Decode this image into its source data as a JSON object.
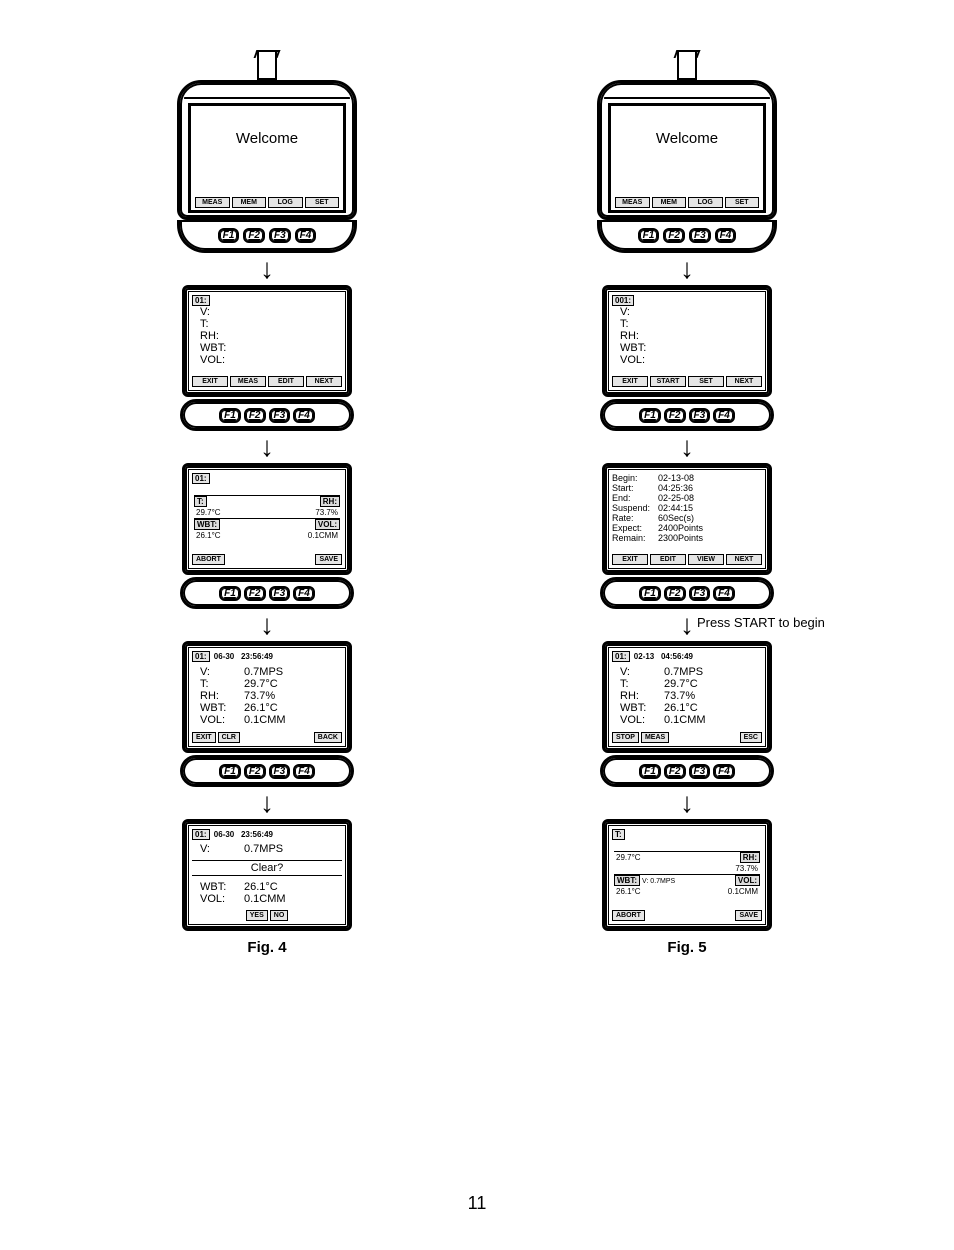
{
  "page_number": "11",
  "fig4": {
    "caption": "Fig. 4",
    "device": {
      "welcome": "Welcome",
      "softkeys": [
        "MEAS",
        "MEM",
        "LOG",
        "SET"
      ],
      "fkeys": [
        "F1",
        "F2",
        "F3",
        "F4"
      ]
    },
    "step2": {
      "id": "01:",
      "rows": [
        "V:",
        "T:",
        "RH:",
        "WBT:",
        "VOL:"
      ],
      "softkeys": [
        "EXIT",
        "MEAS",
        "EDIT",
        "NEXT"
      ]
    },
    "step3": {
      "id": "01:",
      "cells": {
        "t_label": "T:",
        "t_val": "29.7°C",
        "rh_label": "RH:",
        "rh_val": "73.7%",
        "wbt_label": "WBT:",
        "wbt_val": "26.1°C",
        "vol_label": "VOL:",
        "vol_val": "0.1CMM"
      },
      "soft_left": "ABORT",
      "soft_right": "SAVE"
    },
    "step4": {
      "id": "01:",
      "date": "06-30",
      "time": "23:56:49",
      "rows": [
        [
          "V:",
          "0.7MPS"
        ],
        [
          "T:",
          "29.7°C"
        ],
        [
          "RH:",
          "73.7%"
        ],
        [
          "WBT:",
          "26.1°C"
        ],
        [
          "VOL:",
          "0.1CMM"
        ]
      ],
      "softkeys": [
        "EXIT",
        "CLR",
        "",
        "BACK"
      ]
    },
    "step5": {
      "id": "01:",
      "date": "06-30",
      "time": "23:56:49",
      "top": [
        [
          "V:",
          "0.7MPS"
        ]
      ],
      "dialog": "Clear?",
      "bottom": [
        [
          "WBT:",
          "26.1°C"
        ],
        [
          "VOL:",
          "0.1CMM"
        ]
      ],
      "softkeys": [
        "",
        "YES",
        "NO",
        ""
      ]
    }
  },
  "fig5": {
    "caption": "Fig. 5",
    "annotation": "Press START to begin",
    "device": {
      "welcome": "Welcome",
      "softkeys": [
        "MEAS",
        "MEM",
        "LOG",
        "SET"
      ],
      "fkeys": [
        "F1",
        "F2",
        "F3",
        "F4"
      ]
    },
    "step2": {
      "id": "001:",
      "rows": [
        "V:",
        "T:",
        "RH:",
        "WBT:",
        "VOL:"
      ],
      "softkeys": [
        "EXIT",
        "START",
        "SET",
        "NEXT"
      ]
    },
    "step3": {
      "rows": [
        [
          "Begin:",
          "02-13-08"
        ],
        [
          "Start:",
          "04:25:36"
        ],
        [
          "End:",
          "02-25-08"
        ],
        [
          "Suspend:",
          "02:44:15"
        ],
        [
          "Rate:",
          "60Sec(s)"
        ],
        [
          "Expect:",
          "2400Points"
        ],
        [
          "Remain:",
          "2300Points"
        ]
      ],
      "softkeys": [
        "EXIT",
        "EDIT",
        "VIEW",
        "NEXT"
      ]
    },
    "step4": {
      "id": "01:",
      "date": "02-13",
      "time": "04:56:49",
      "rows": [
        [
          "V:",
          "0.7MPS"
        ],
        [
          "T:",
          "29.7°C"
        ],
        [
          "RH:",
          "73.7%"
        ],
        [
          "WBT:",
          "26.1°C"
        ],
        [
          "VOL:",
          "0.1CMM"
        ]
      ],
      "softkeys": [
        "STOP",
        "MEAS",
        "",
        "ESC"
      ]
    },
    "step5": {
      "t_label": "T:",
      "t_val": "29.7°C",
      "v_note": "V:  0.7MPS",
      "rh_label": "RH:",
      "rh_val": "73.7%",
      "wbt_label": "WBT:",
      "wbt_val": "26.1°C",
      "vol_label": "VOL:",
      "vol_val": "0.1CMM",
      "soft_left": "ABORT",
      "soft_right": "SAVE"
    }
  }
}
